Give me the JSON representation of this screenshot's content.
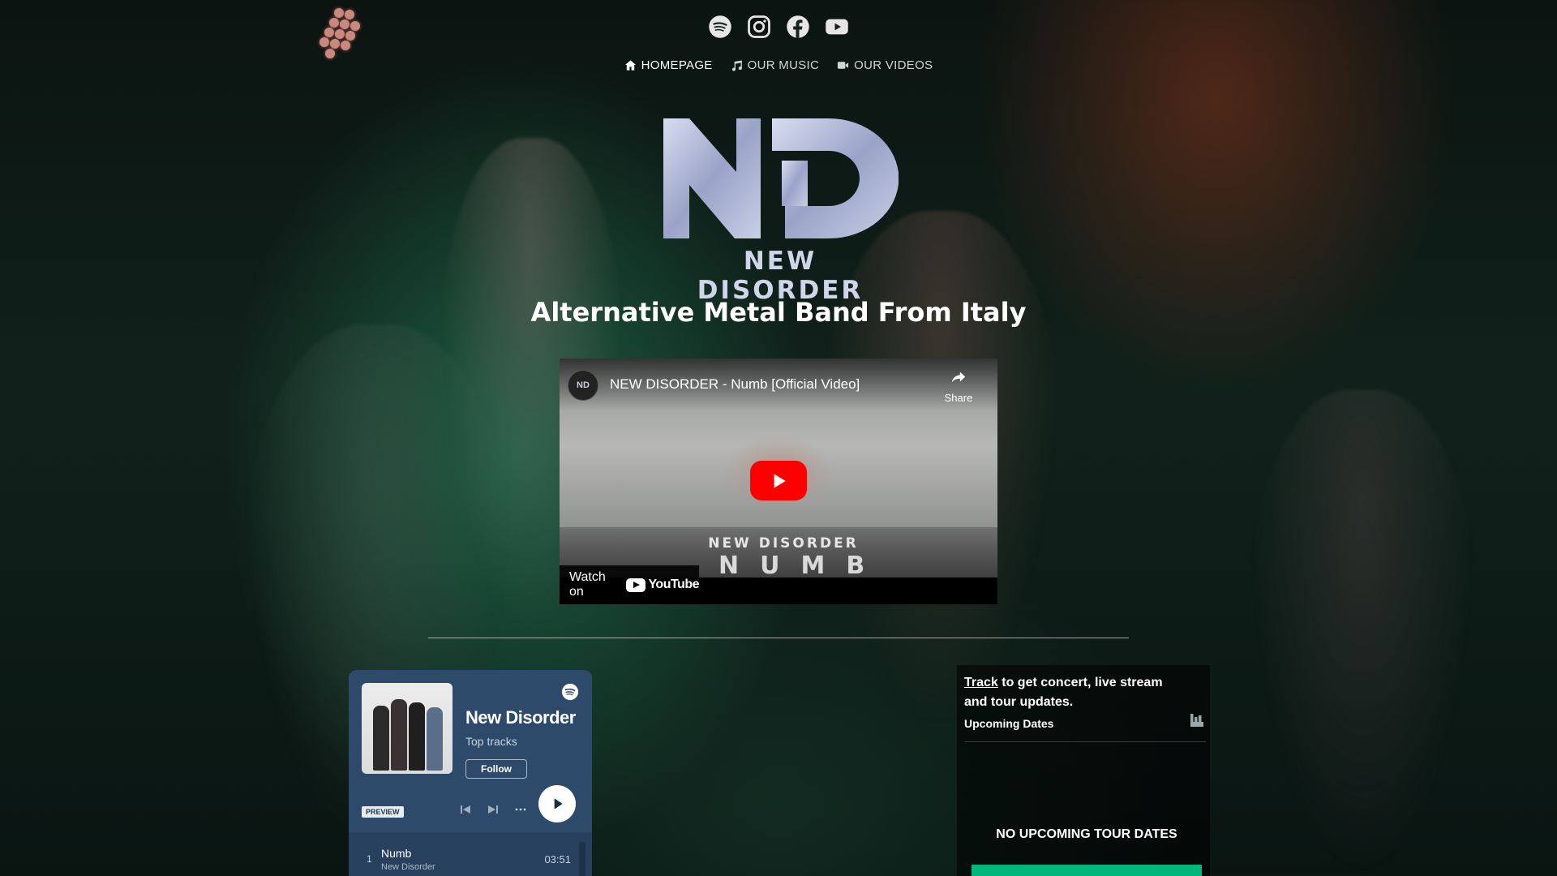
{
  "social": [
    {
      "name": "spotify-icon"
    },
    {
      "name": "instagram-icon"
    },
    {
      "name": "facebook-icon"
    },
    {
      "name": "youtube-icon"
    }
  ],
  "nav": {
    "items": [
      {
        "label": "HOMEPAGE",
        "icon": "home-icon",
        "active": true
      },
      {
        "label": "OUR MUSIC",
        "icon": "music-note-icon",
        "active": false
      },
      {
        "label": "OUR VIDEOS",
        "icon": "video-camera-icon",
        "active": false
      }
    ]
  },
  "logo": {
    "mark": "ND",
    "text": "NEW DISORDER"
  },
  "tagline": "Alternative Metal Band From Italy",
  "video": {
    "title": "NEW DISORDER - Numb [Official Video]",
    "share_label": "Share",
    "overlay_band": "NEW DISORDER",
    "overlay_song": "NUMB",
    "watch_on": "Watch on",
    "yt_logo_text": "YouTube",
    "avatar": "ND"
  },
  "spotify": {
    "artist": "New Disorder",
    "subtitle": "Top tracks",
    "follow_label": "Follow",
    "preview_label": "PREVIEW",
    "tracks": [
      {
        "num": "1",
        "title": "Numb",
        "artist": "New Disorder",
        "duration": "03:51"
      }
    ],
    "colors": {
      "bg": "#2d4a6a",
      "accent": "#1db954"
    }
  },
  "bandsintown": {
    "track_link": "Track",
    "message": " to get concert, live stream and tour updates.",
    "upcoming_label": "Upcoming Dates",
    "empty_label": "NO UPCOMING TOUR DATES",
    "button_color": "#00b67a"
  }
}
